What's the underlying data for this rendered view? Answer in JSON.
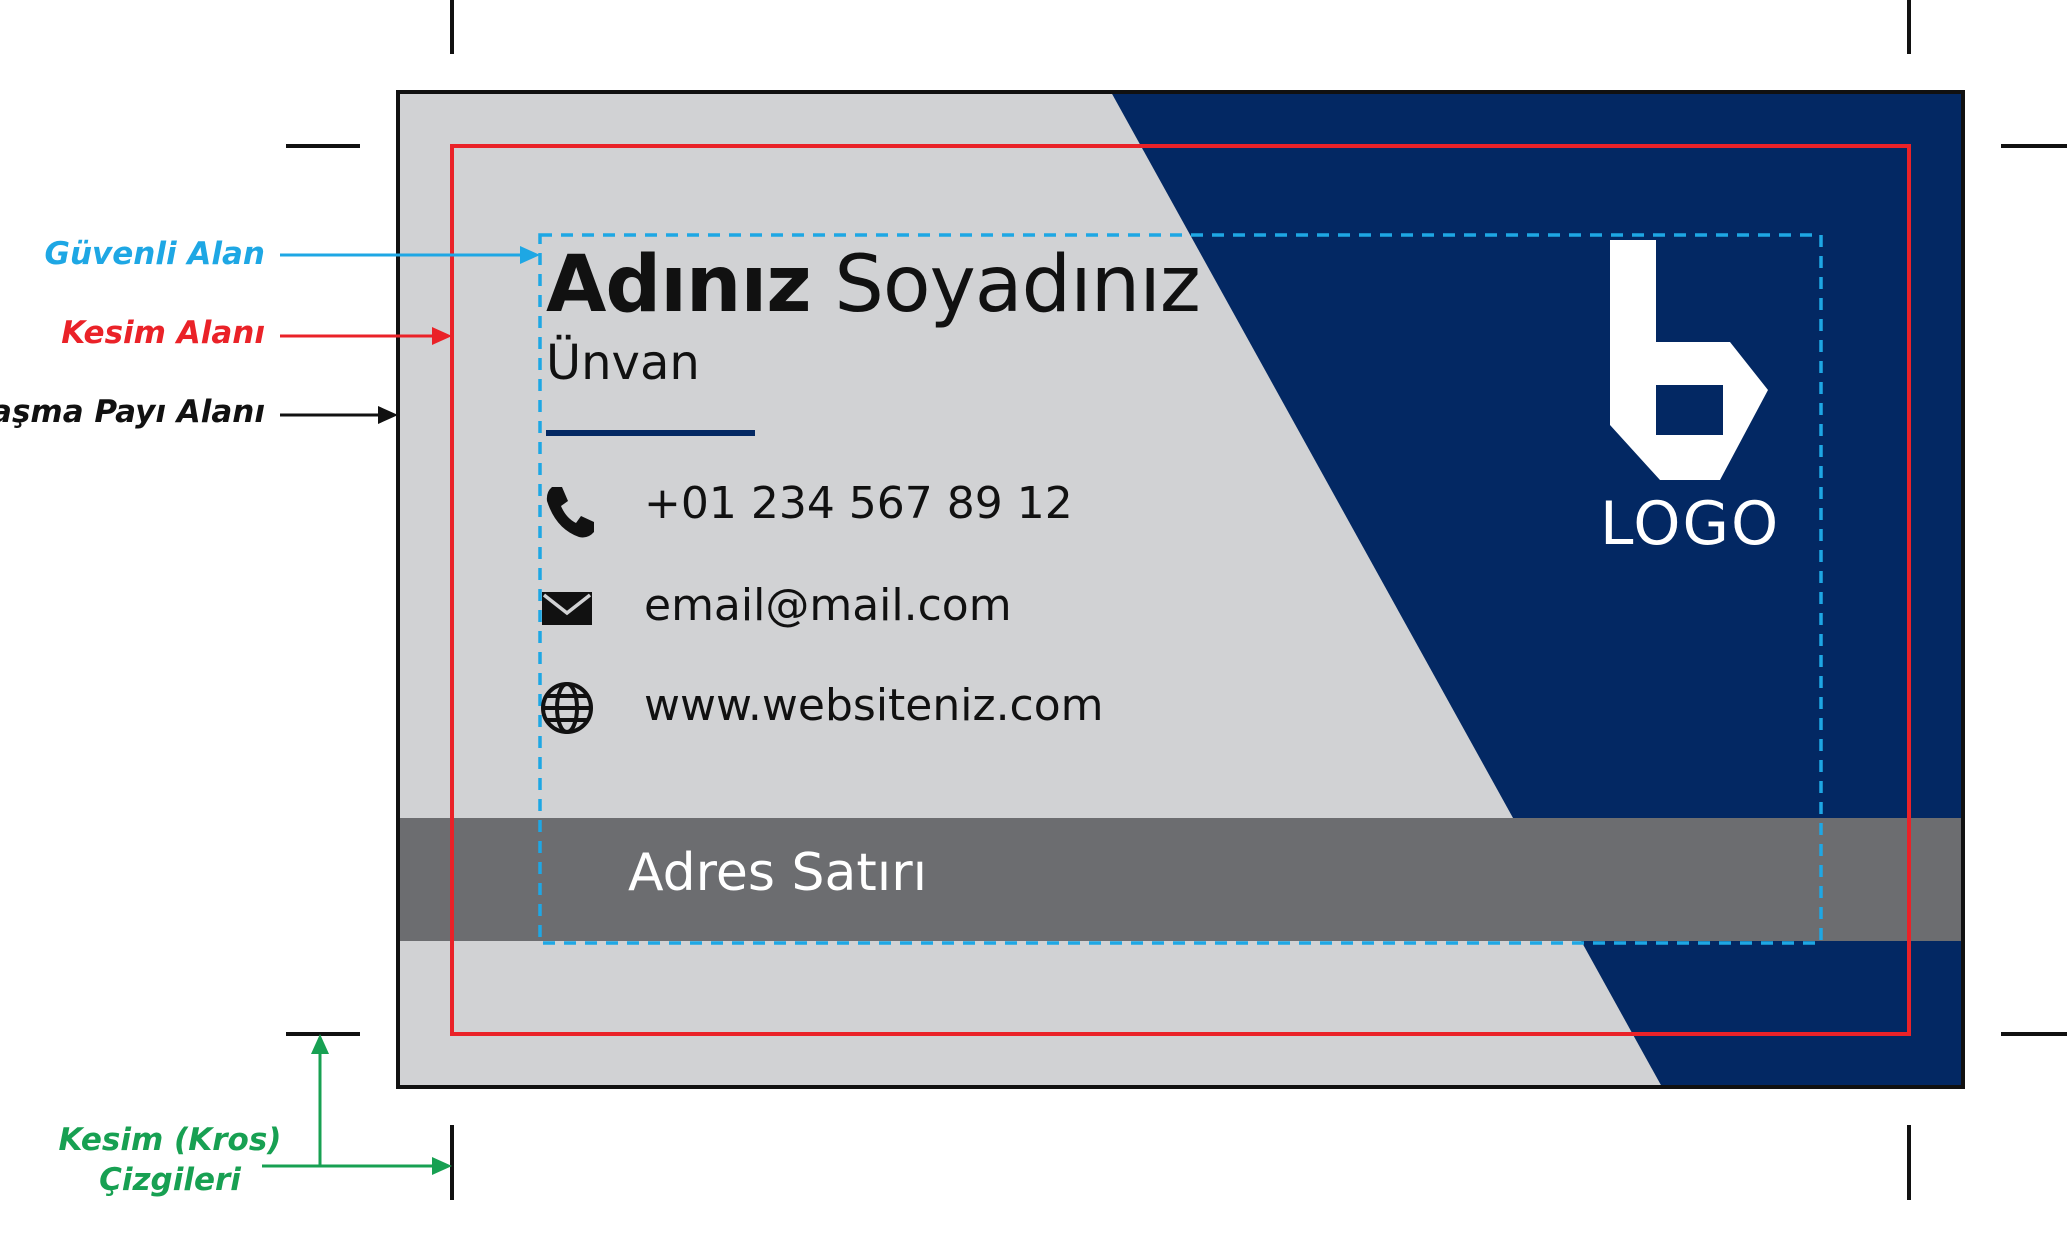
{
  "annotations": {
    "safe_area": "Güvenli Alan",
    "cut_area": "Kesim Alanı",
    "bleed_area": "Taşma Payı Alanı",
    "crop_marks_line1": "Kesim (Kros)",
    "crop_marks_line2": "Çizgileri"
  },
  "card": {
    "first_name": "Adınız",
    "last_name": "Soyadınız",
    "title": "Ünvan",
    "phone": "+01 234 567 89 12",
    "email": "email@mail.com",
    "website": "www.websiteniz.com",
    "address": "Adres Satırı",
    "logo_text": "LOGO"
  },
  "icons": {
    "phone": "phone-icon",
    "email": "envelope-icon",
    "website": "globe-icon",
    "logo": "b-logo-icon"
  },
  "colors": {
    "card_background": "#d1d2d4",
    "navy": "#032863",
    "address_bar": "#6c6d70",
    "safe_area": "#1ea7e4",
    "cut_area": "#ea2228",
    "crop_marks": "#17a052",
    "bleed": "#111111"
  }
}
